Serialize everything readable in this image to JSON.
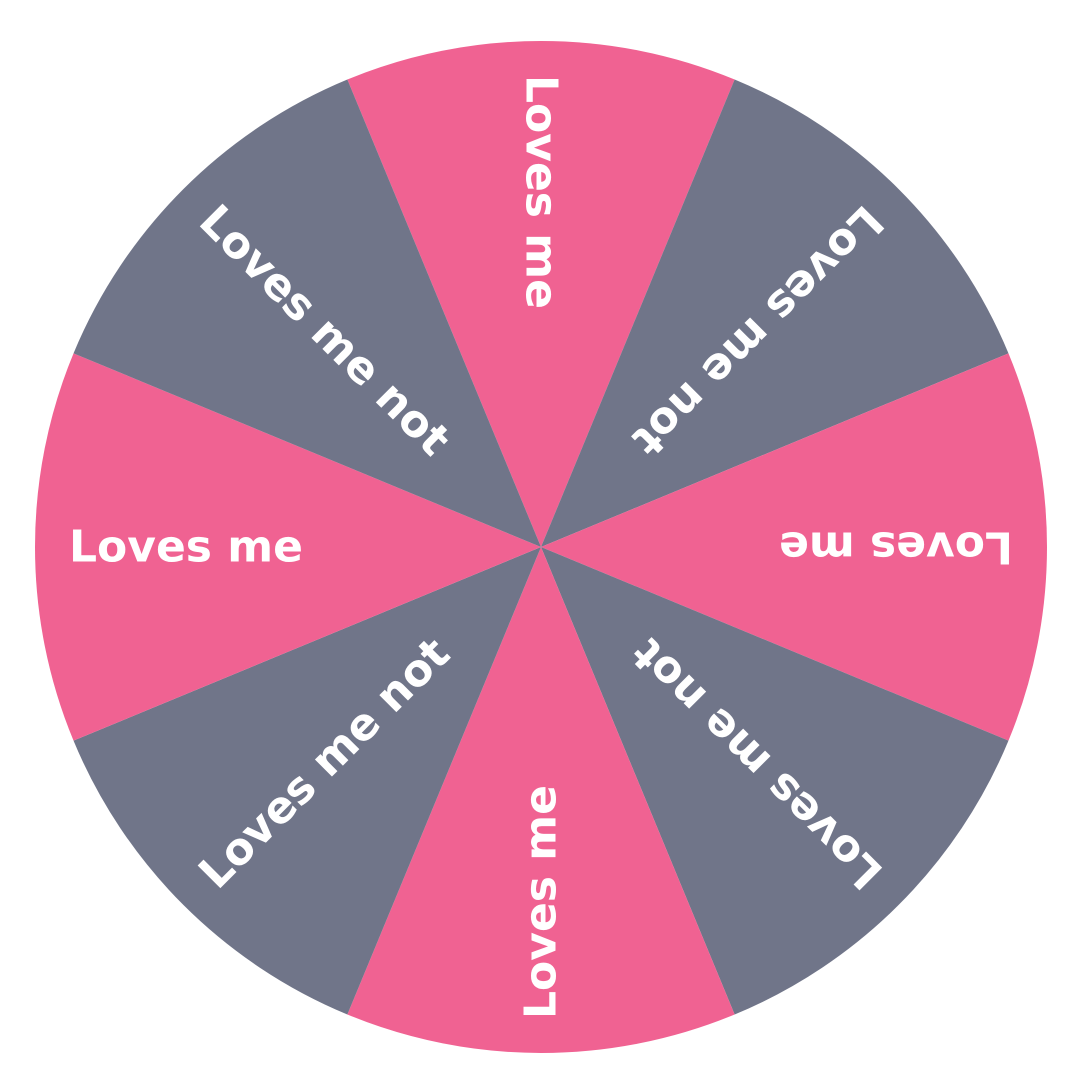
{
  "wheel": {
    "colors": {
      "pink": "#f06292",
      "gray": "#707589",
      "text": "#ffffff"
    },
    "slices": [
      {
        "label": "Loves me",
        "color": "pink"
      },
      {
        "label": "Loves me not",
        "color": "gray"
      },
      {
        "label": "Loves me",
        "color": "pink"
      },
      {
        "label": "Loves me not",
        "color": "gray"
      },
      {
        "label": "Loves me",
        "color": "pink"
      },
      {
        "label": "Loves me not",
        "color": "gray"
      },
      {
        "label": "Loves me",
        "color": "pink"
      },
      {
        "label": "Loves me not",
        "color": "gray"
      }
    ]
  }
}
